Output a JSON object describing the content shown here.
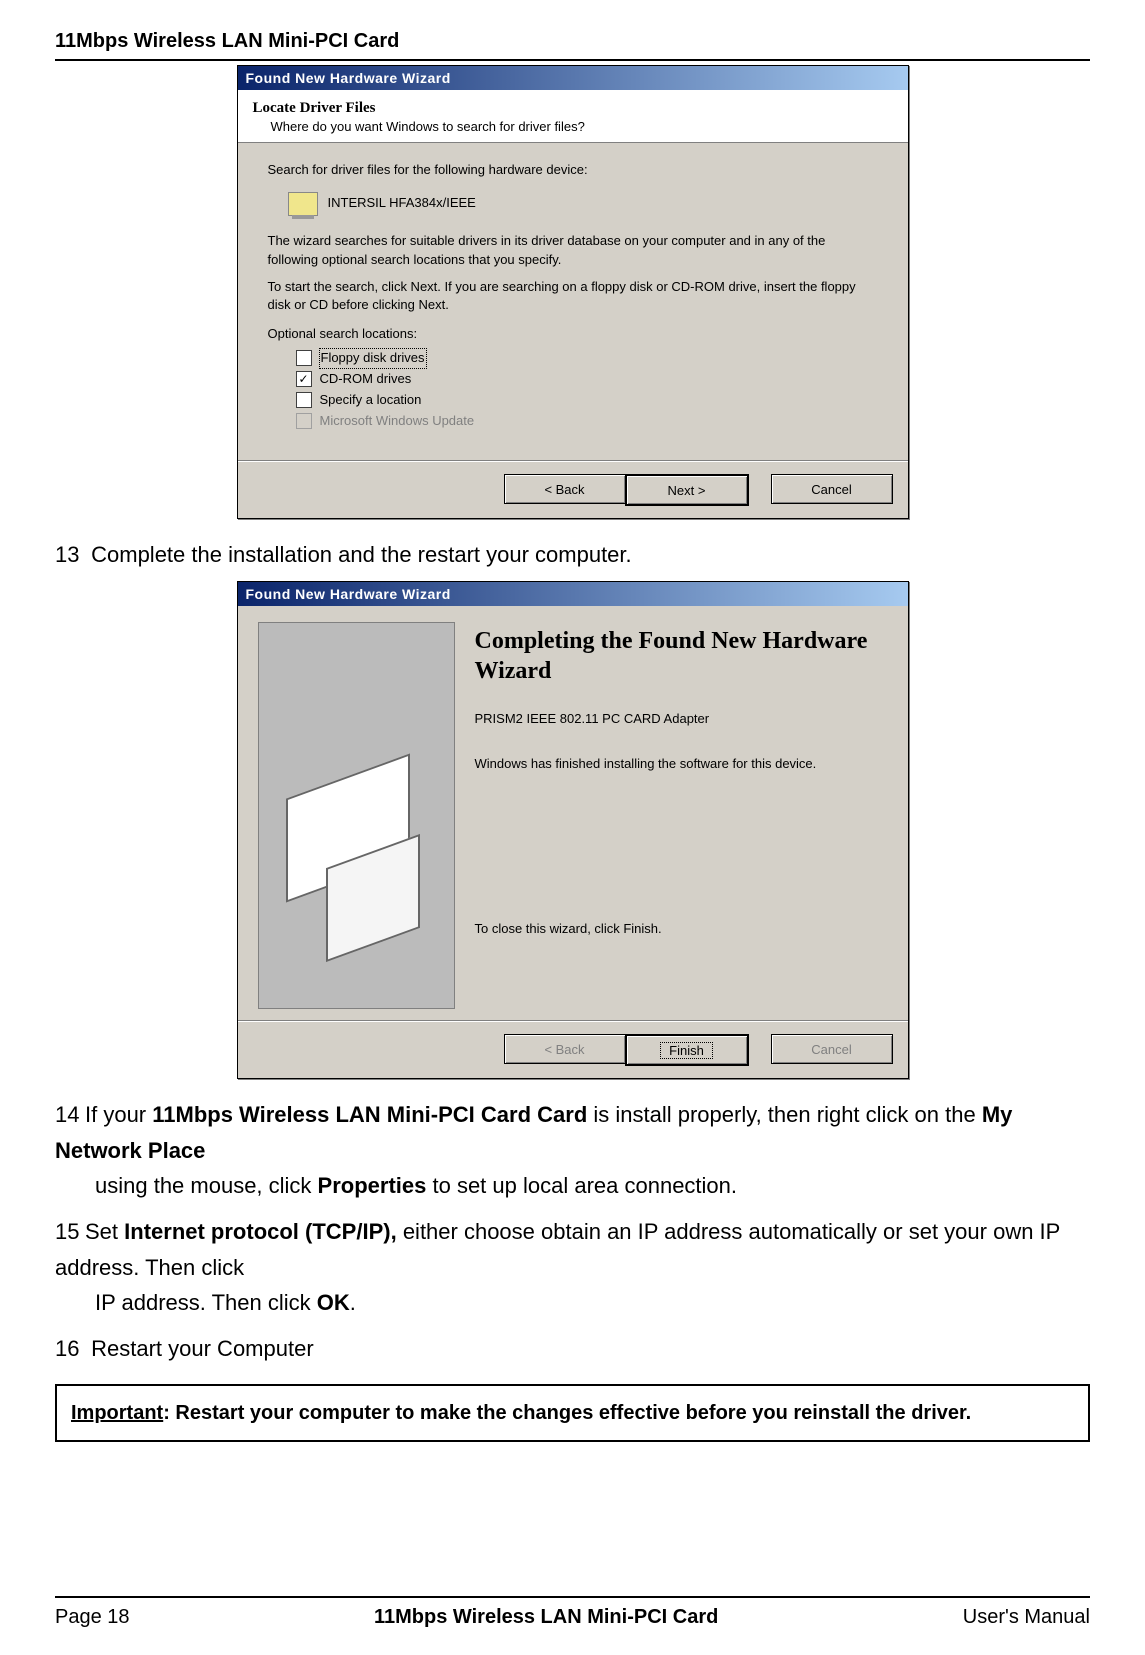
{
  "header": {
    "title": "11Mbps Wireless LAN Mini-PCI Card"
  },
  "wizard1": {
    "title": "Found New Hardware Wizard",
    "heading": "Locate Driver Files",
    "subheading": "Where do you want Windows to search for driver files?",
    "body1": "Search for driver files for the following hardware device:",
    "device": "INTERSIL HFA384x/IEEE",
    "body2": "The wizard searches for suitable drivers in its driver database on your computer and in any of the following optional search locations that you specify.",
    "body3": "To start the search, click Next. If you are searching on a floppy disk or CD-ROM drive, insert the floppy disk or CD before clicking Next.",
    "opt_label": "Optional search locations:",
    "options": [
      {
        "label": "Floppy disk drives",
        "checked": false,
        "disabled": false,
        "focused": true
      },
      {
        "label": "CD-ROM drives",
        "checked": true,
        "disabled": false,
        "focused": false
      },
      {
        "label": "Specify a location",
        "checked": false,
        "disabled": false,
        "focused": false
      },
      {
        "label": "Microsoft Windows Update",
        "checked": false,
        "disabled": true,
        "focused": false
      }
    ],
    "buttons": {
      "back": "< Back",
      "next": "Next >",
      "cancel": "Cancel"
    }
  },
  "step13": {
    "num": "13",
    "text": "Complete the installation and the restart your computer."
  },
  "wizard2": {
    "title": "Found New Hardware Wizard",
    "heading": "Completing the Found New Hardware Wizard",
    "model": "PRISM2 IEEE 802.11 PC CARD Adapter",
    "body1": "Windows has finished installing the software for this device.",
    "body2": "To close this wizard, click Finish.",
    "buttons": {
      "back": "< Back",
      "finish": "Finish",
      "cancel": "Cancel"
    }
  },
  "step14": {
    "num": "14",
    "pre": "If your ",
    "b1": "11Mbps Wireless LAN Mini-PCI Card Card",
    "mid1": " is install properly, then right click on the ",
    "b2": "My Network Place",
    "mid2": " using the mouse, click ",
    "b3": "Properties",
    "post": " to set up local area connection."
  },
  "step15": {
    "num": "15",
    "pre": "Set ",
    "b1": "Internet protocol (TCP/IP),",
    "mid": " either choose obtain an IP address automatically or set your own IP address. Then click ",
    "b2": "OK",
    "post": "."
  },
  "step16": {
    "num": "16",
    "text": "Restart your Computer"
  },
  "callout": {
    "u": "Important",
    "text": ": Restart your computer to make the changes effective before you reinstall the driver."
  },
  "footer": {
    "left": "Page 18",
    "mid": "11Mbps Wireless LAN Mini-PCI Card",
    "right": "User's Manual"
  }
}
